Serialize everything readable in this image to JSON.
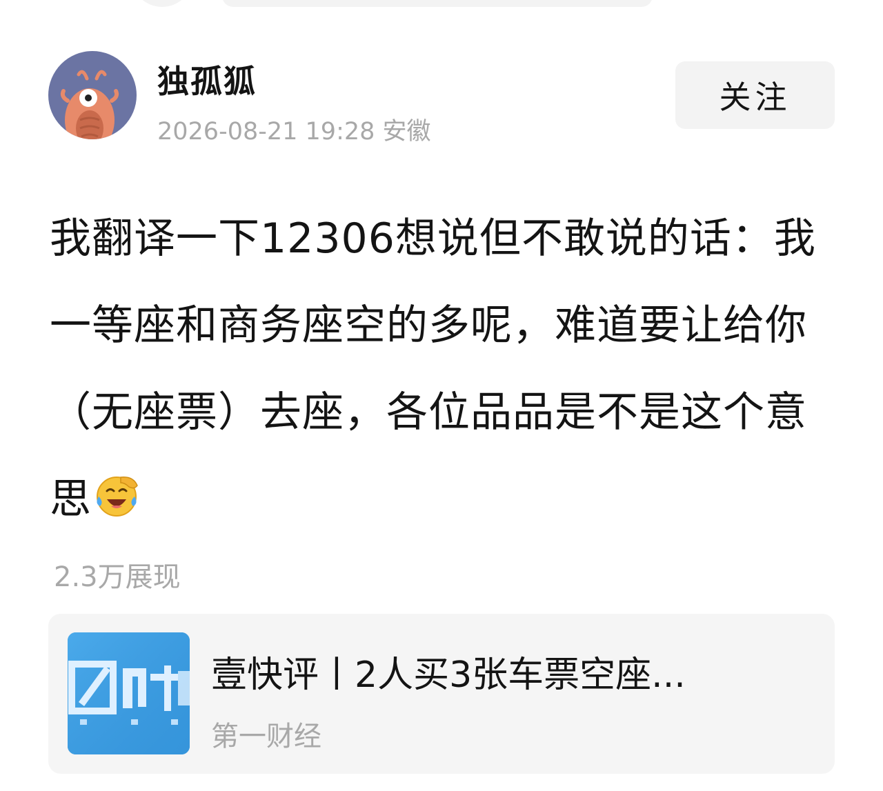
{
  "post": {
    "author": {
      "name": "独孤狐",
      "avatar_icon": "cartoon-shrimp-avatar",
      "avatar_bg": "#6b74a3"
    },
    "meta": "2026-08-21 19:28 安徽",
    "follow_label": "关注",
    "body_text": "我翻译一下12306想说但不敢说的话：我一等座和商务座空的多呢，难道要让给你（无座票）去座，各位品品是不是这个意思",
    "body_emoji": "laughing-crying-emoji",
    "view_count": "2.3万展现"
  },
  "link_card": {
    "title": "壹快评丨2人买3张车票空座...",
    "source": "第一财经",
    "thumb_icon": "first-finance-logo",
    "thumb_bg": "#3a9be0"
  }
}
